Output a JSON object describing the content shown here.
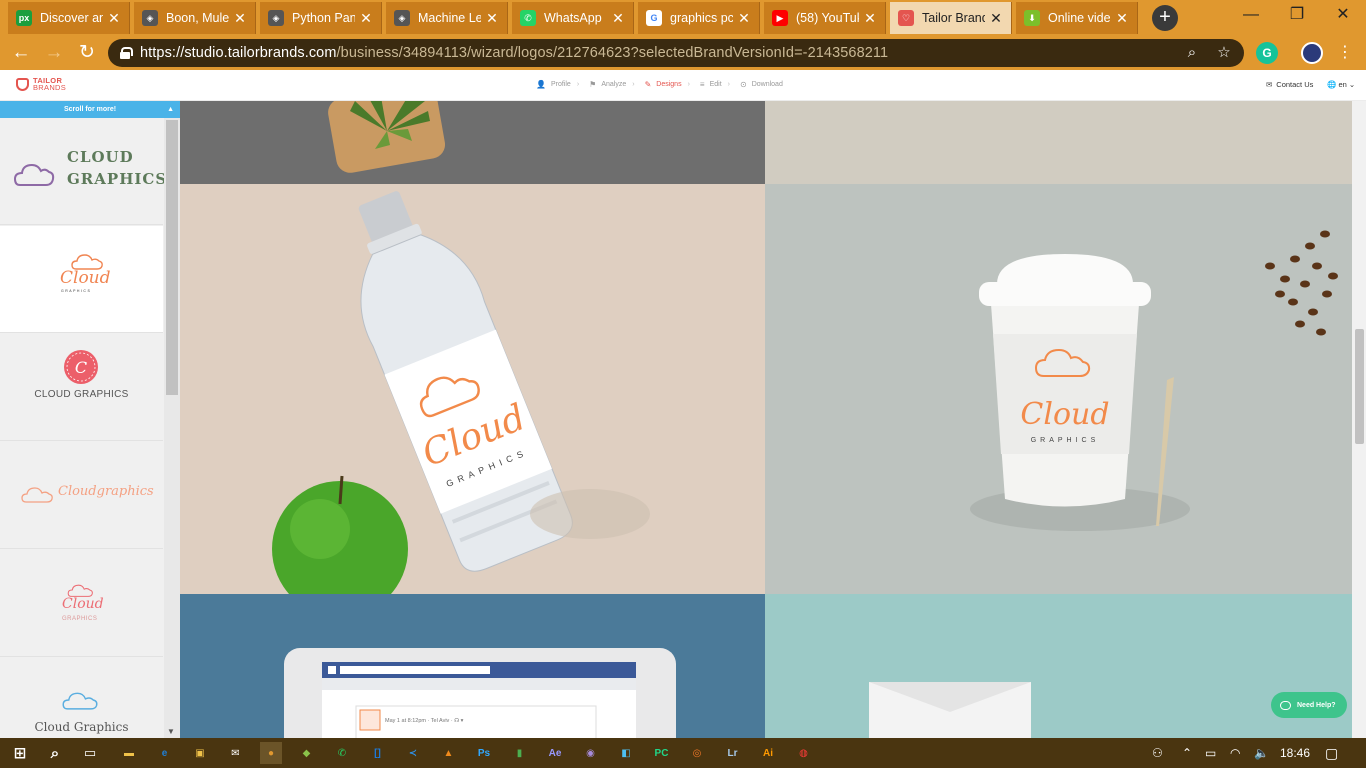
{
  "browser": {
    "tabs": [
      {
        "title": "Discover an",
        "favicon": "pixabay-icon",
        "color": "#1a9f3d",
        "glyph": "px"
      },
      {
        "title": "Boon, Mule",
        "favicon": "site-icon",
        "color": "#555555",
        "glyph": "◈"
      },
      {
        "title": "Python Pan",
        "favicon": "site-icon",
        "color": "#555555",
        "glyph": "◈"
      },
      {
        "title": "Machine Le",
        "favicon": "site-icon",
        "color": "#555555",
        "glyph": "◈"
      },
      {
        "title": "WhatsApp",
        "favicon": "whatsapp-icon",
        "color": "#25d366",
        "glyph": "✆"
      },
      {
        "title": "graphics pc",
        "favicon": "google-icon",
        "color": "#ffffff",
        "glyph": "G"
      },
      {
        "title": "(58) YouTuk",
        "favicon": "youtube-icon",
        "color": "#ff0000",
        "glyph": "▶"
      },
      {
        "title": "Tailor Brand",
        "favicon": "tailorbrands-icon",
        "color": "#e4554f",
        "glyph": "♡"
      },
      {
        "title": "Online vide",
        "favicon": "download-icon",
        "color": "#7cbf2a",
        "glyph": "⬇"
      }
    ],
    "new_tab": "+",
    "url_host": "https://studio.tailorbrands.com",
    "url_path": "/business/34894113/wizard/logos/212764623?selectedBrandVersionId=-2143568211"
  },
  "site": {
    "brand_line1": "TAILOR",
    "brand_line2": "BRANDS",
    "steps": [
      {
        "label": "Profile",
        "icon": "person-icon",
        "glyph": "👤"
      },
      {
        "label": "Analyze",
        "icon": "flag-icon",
        "glyph": "⚑"
      },
      {
        "label": "Designs",
        "icon": "pencil-icon",
        "glyph": "✎"
      },
      {
        "label": "Edit",
        "icon": "sliders-icon",
        "glyph": "≡"
      },
      {
        "label": "Download",
        "icon": "download-circle-icon",
        "glyph": "⊙"
      }
    ],
    "active_step": "Designs",
    "contact": "Contact Us",
    "lang": "en"
  },
  "sidebar": {
    "scroll_hint": "Scroll for more!",
    "logos": [
      {
        "line1": "CLOUD",
        "line2": "GRAPHICS"
      },
      {
        "line1": "Cloud",
        "line2": "GRAPHICS"
      },
      {
        "line1": "C",
        "line2": "CLOUD GRAPHICS"
      },
      {
        "line1": "Cloudgraphics"
      },
      {
        "line1": "Cloud",
        "line2": "GRAPHICS"
      },
      {
        "line1": "Cloud Graphics"
      }
    ]
  },
  "mockups": {
    "bottle_word": "Cloud",
    "bottle_sub": "GRAPHICS",
    "cup_word": "Cloud",
    "cup_sub": "GRAPHICS",
    "fb_post": "May 1 at 8:12pm · Tel Aviv · ☊ ▾"
  },
  "help_button": "Need Help?",
  "taskbar": {
    "time": "18:46",
    "apps": [
      {
        "name": "file-explorer-icon",
        "glyph": "▬",
        "color": "#f0c24a"
      },
      {
        "name": "edge-icon",
        "glyph": "e",
        "color": "#1f7fd6"
      },
      {
        "name": "store-icon",
        "glyph": "▣",
        "color": "#f0c24a"
      },
      {
        "name": "mail-icon",
        "glyph": "✉",
        "color": "#ffffff"
      },
      {
        "name": "chrome-icon",
        "glyph": "●",
        "color": "#e0982f"
      },
      {
        "name": "android-icon",
        "glyph": "◆",
        "color": "#8bc34a"
      },
      {
        "name": "whatsapp-icon",
        "glyph": "✆",
        "color": "#25d366"
      },
      {
        "name": "bracket-icon",
        "glyph": "[]",
        "color": "#1e7ad8"
      },
      {
        "name": "vscode-icon",
        "glyph": "≺",
        "color": "#2f8fe3"
      },
      {
        "name": "vlc-icon",
        "glyph": "▲",
        "color": "#f08a1c"
      },
      {
        "name": "photoshop-icon",
        "glyph": "Ps",
        "color": "#31a8ff"
      },
      {
        "name": "bucket-icon",
        "glyph": "▮",
        "color": "#4caf50"
      },
      {
        "name": "after-effects-icon",
        "glyph": "Ae",
        "color": "#9999ff"
      },
      {
        "name": "browser-icon",
        "glyph": "◉",
        "color": "#a78bdb"
      },
      {
        "name": "media-icon",
        "glyph": "◧",
        "color": "#4ec0f0"
      },
      {
        "name": "pycharm-icon",
        "glyph": "PC",
        "color": "#21d789"
      },
      {
        "name": "blender-icon",
        "glyph": "◎",
        "color": "#f5792a"
      },
      {
        "name": "lightroom-icon",
        "glyph": "Lr",
        "color": "#a6c8e8"
      },
      {
        "name": "illustrator-icon",
        "glyph": "Ai",
        "color": "#ff9a00"
      },
      {
        "name": "creative-cloud-icon",
        "glyph": "◍",
        "color": "#ff3b3b"
      }
    ]
  }
}
